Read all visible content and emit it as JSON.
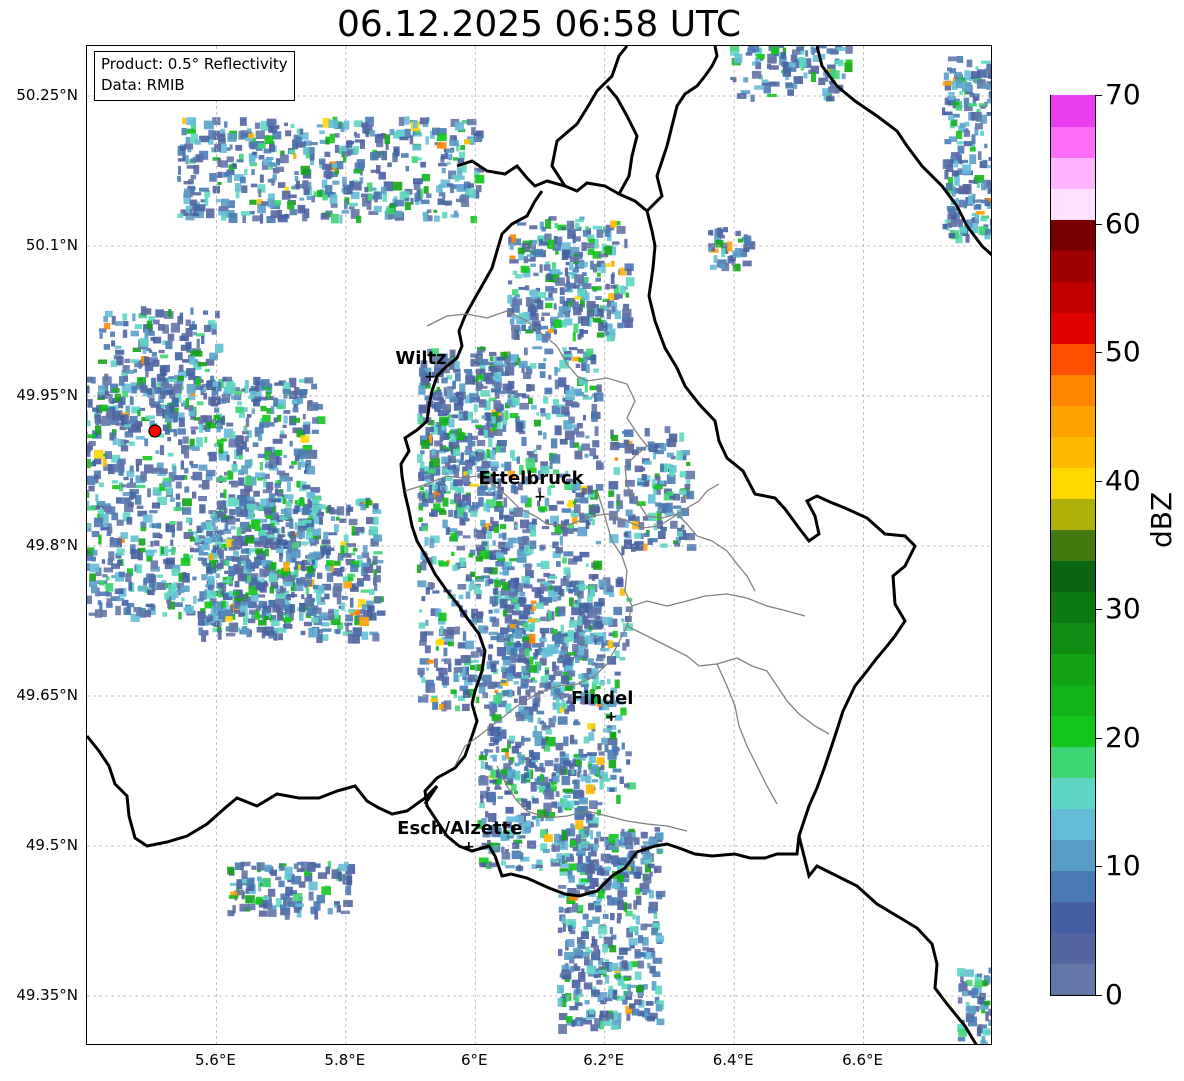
{
  "title": "06.12.2025 06:58 UTC",
  "info_box": {
    "product": "Product: 0.5° Reflectivity",
    "data_source": "Data: RMIB"
  },
  "axes": {
    "lat_labels": [
      "50.25°N",
      "50.1°N",
      "49.95°N",
      "49.8°N",
      "49.65°N",
      "49.5°N",
      "49.35°N"
    ],
    "lon_labels": [
      "5.6°E",
      "5.8°E",
      "6°E",
      "6.2°E",
      "6.4°E",
      "6.6°E"
    ],
    "lat_values": [
      50.25,
      50.1,
      49.95,
      49.8,
      49.65,
      49.5,
      49.35
    ],
    "lon_values": [
      5.6,
      5.8,
      6.0,
      6.2,
      6.4,
      6.6
    ],
    "lat_range": [
      49.3,
      50.3
    ],
    "lon_range": [
      5.4,
      6.8
    ],
    "grid": true
  },
  "cities": [
    {
      "name": "Wiltz",
      "lat": 49.97,
      "lon": 5.93
    },
    {
      "name": "Ettelbruck",
      "lat": 49.85,
      "lon": 6.1
    },
    {
      "name": "Findel",
      "lat": 49.63,
      "lon": 6.21
    },
    {
      "name": "Esch/Alzette",
      "lat": 49.5,
      "lon": 5.99
    }
  ],
  "radar_site": {
    "lat": 49.915,
    "lon": 5.505,
    "color": "#ff0000"
  },
  "colorbar": {
    "label": "dBZ",
    "tick_labels": [
      "70",
      "60",
      "50",
      "40",
      "30",
      "20",
      "10",
      "0"
    ],
    "tick_values": [
      70,
      60,
      50,
      40,
      30,
      20,
      10,
      0
    ],
    "range": [
      0,
      70
    ],
    "colors": [
      "#6476a8",
      "#5565a0",
      "#4560a2",
      "#4a7ab4",
      "#5a9ec8",
      "#64bcd8",
      "#5ed6c4",
      "#3fd474",
      "#12c61a",
      "#12b41a",
      "#12a414",
      "#0f8c12",
      "#0c7a10",
      "#0a6410",
      "#437a10",
      "#aeb00a",
      "#ffd800",
      "#ffba00",
      "#ffa200",
      "#ff8400",
      "#ff5000",
      "#e00000",
      "#c00000",
      "#a00000",
      "#7a0000",
      "#ffe0ff",
      "#ffb4ff",
      "#ff6cf6",
      "#ea3cf0"
    ]
  }
}
